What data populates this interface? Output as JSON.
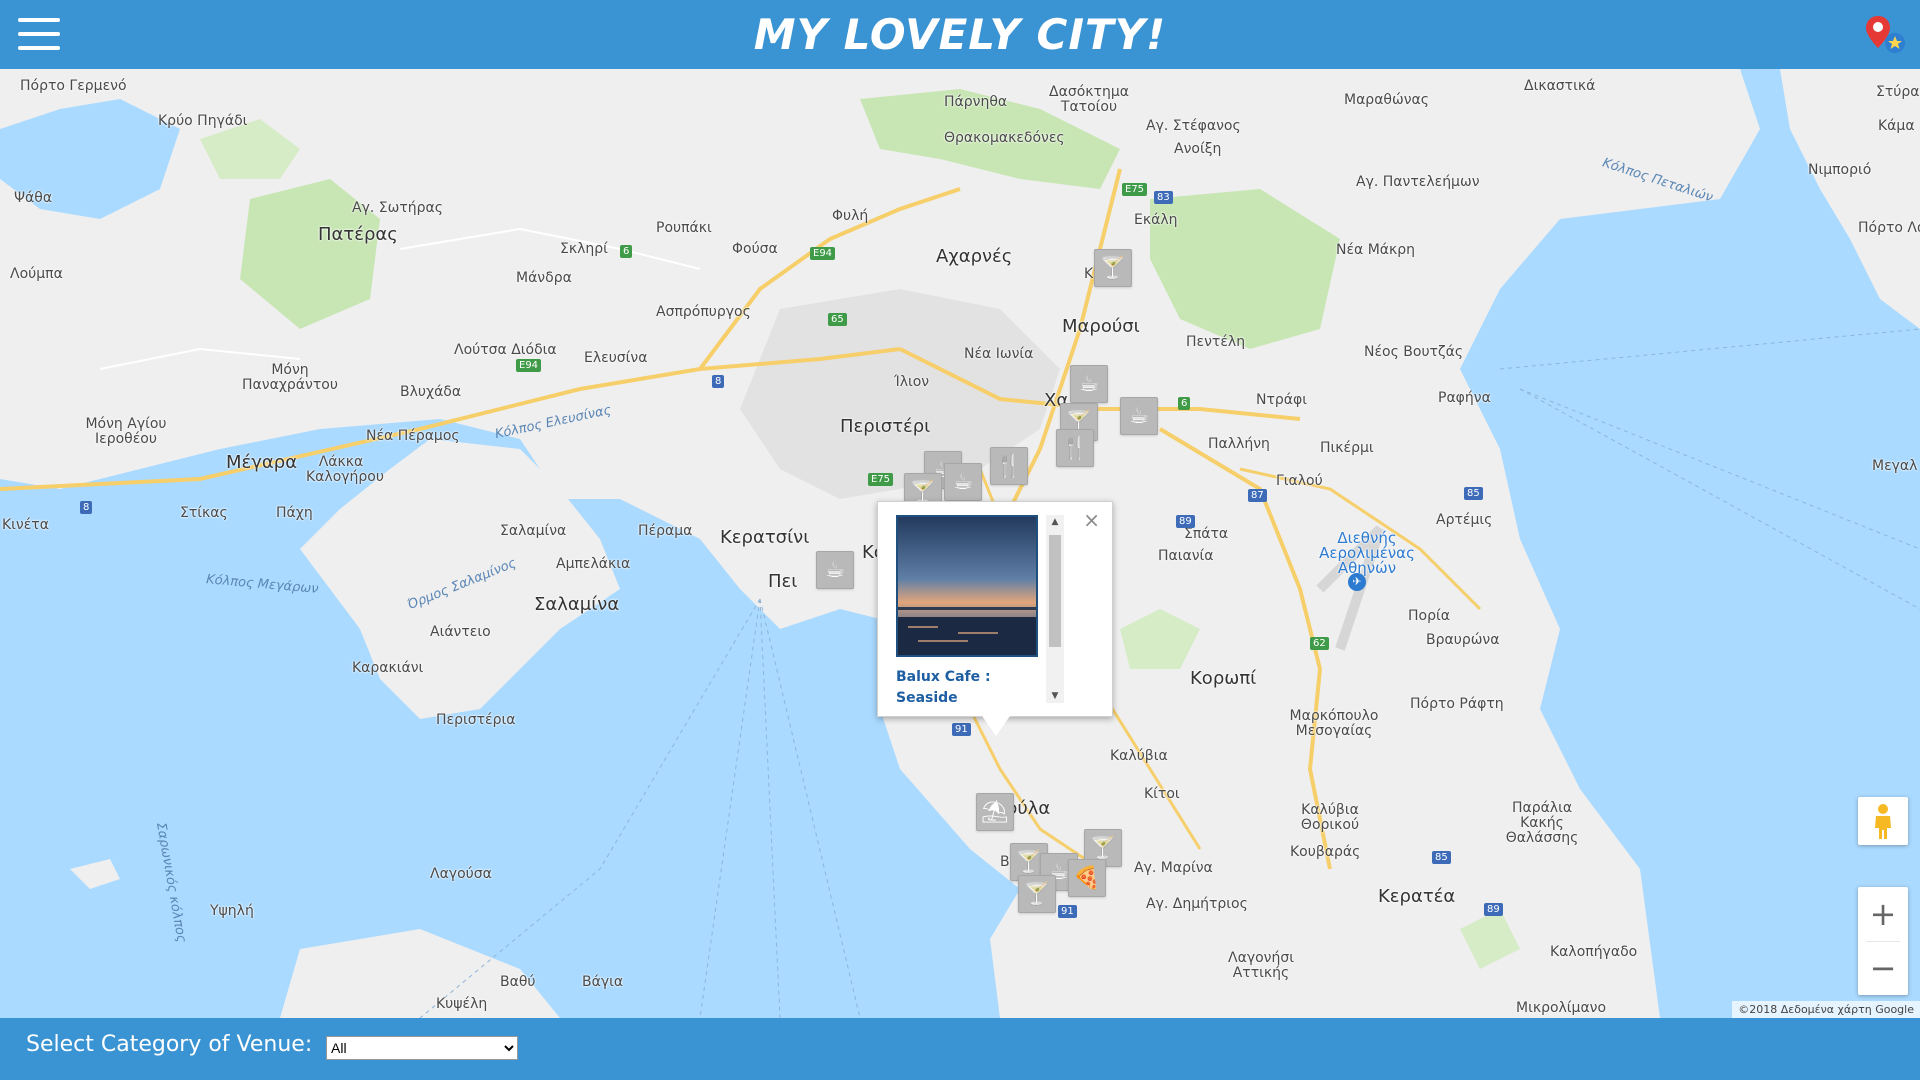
{
  "header": {
    "title": "MY LOVELY CITY!",
    "menu_icon": "hamburger-menu-icon",
    "logo_icon": "map-pin-star-icon"
  },
  "colors": {
    "brand_blue": "#3a93d2",
    "sea": "#aadaff",
    "land": "#eeeeee",
    "park": "#c8e6b4",
    "motorway": "#f7cf6a",
    "venue_marker": "#b9b9b9"
  },
  "map": {
    "places": [
      "Πόρτο Γερμενό",
      "Κρύο Πηγάδι",
      "Ψάθα",
      "Λούμπα",
      "Αγ. Σωτήρας",
      "Πατέρας",
      "Ρουπάκι",
      "Σκληρί",
      "Φούσα",
      "Μάνδρα",
      "Φυλή",
      "Πάρνηθα",
      "Δασόκτημα Τατοίου",
      "Θρακομακεδόνες",
      "Αγ. Στέφανος",
      "Ανοίξη",
      "Μαραθώνας",
      "Δικαστικά",
      "Στύρα",
      "Κάμα",
      "Νιμποριό",
      "Πόρτο Λά",
      "Αγ. Παντελεήμων",
      "Εκάλη",
      "Αχαρνές",
      "Ασπρόπυργος",
      "Νέα Μάκρη",
      "Λούτσα Διόδια",
      "Ελευσίνα",
      "Μαρούσι",
      "Πεντέλη",
      "Νέος Βουτζάς",
      "Ραφήνα",
      "Μόνη Παναχράντου",
      "Βλυχάδα",
      "Νέα Ιωνία",
      "Ίλιον",
      "Μόνη Αγίου Ιεροθέου",
      "Νέα Πέραμος",
      "Περιστέρι",
      "Χα",
      "Ντράφι",
      "Παλλήνη",
      "Πικέρμι",
      "Μέγαρα",
      "Λάκκα Καλογήρου",
      "Γιαλού",
      "Αρτέμις",
      "Κινέτα",
      "Στίκας",
      "Πάχη",
      "Σαλαμίνα",
      "Πέραμα",
      "Κερατσίνι",
      "Κο",
      "Σπάτα",
      "Παιανία",
      "Αμπελάκια",
      "Πει",
      "Σαλαμίνα",
      "Πορία",
      "Βραυρώνα",
      "Αιάντειο",
      "Κορωπί",
      "Καρακιάνι",
      "Μαρκόπουλο Μεσογαίας",
      "Πόρτο Ράφτη",
      "Περιστέρια",
      "Καλύβια",
      "Κίτοι",
      "Βούλα",
      "Λαγούσα",
      "Υψηλή",
      "Αγ. Μαρίνα",
      "Καλύβια Θορικού",
      "Παράλια Κακής Θαλάσσης",
      "Κουβαράς",
      "Αγ. Δημήτριος",
      "Κερατέα",
      "Βαθύ",
      "Βάγια",
      "Λαγονήσι Αττικής",
      "Καλοπήγαδο",
      "Κυψέλη",
      "Μικρολίμανο",
      "Μεγαλ",
      "Β",
      "Κ",
      "Σπάτα"
    ],
    "sea_names": [
      "Κόλπος Πεταλιών",
      "Κόλπος Ελευσίνας",
      "Κόλπος Μεγάρων",
      "Όρμος Σαλαμίνος",
      "Σαρωνικός κόλπος"
    ],
    "airport": "Διεθνής Αερολιμένας Αθηνών",
    "road_badges": [
      "E75",
      "83",
      "6",
      "E94",
      "65",
      "8",
      "E94",
      "E75",
      "6",
      "87",
      "89",
      "85",
      "62",
      "91",
      "85",
      "89",
      "91",
      "8"
    ],
    "attribution": "©2018 Δεδομένα χάρτη Google",
    "pegman_icon": "street-view-pegman-icon",
    "zoom_in": "+",
    "zoom_out": "−"
  },
  "venues": [
    {
      "icon": "bar-icon"
    },
    {
      "icon": "cafe-icon"
    },
    {
      "icon": "cafe-icon"
    },
    {
      "icon": "bar-icon"
    },
    {
      "icon": "restaurant-icon"
    },
    {
      "icon": "restaurant-icon"
    },
    {
      "icon": "cafe-icon"
    },
    {
      "icon": "bar-icon"
    },
    {
      "icon": "cafe-icon"
    },
    {
      "icon": "cafe-icon"
    },
    {
      "icon": "beach-bar-icon"
    },
    {
      "icon": "cocktail-icon"
    },
    {
      "icon": "bar-icon"
    },
    {
      "icon": "cafe-icon"
    },
    {
      "icon": "bar-icon"
    },
    {
      "icon": "pizza-icon"
    }
  ],
  "infowindow": {
    "venue_name": "Balux Cafe : Seaside",
    "photo_icon": "sunset-seaside-photo",
    "close_label": "×"
  },
  "footer": {
    "label": "Select Category of Venue:",
    "select_value": "All"
  }
}
